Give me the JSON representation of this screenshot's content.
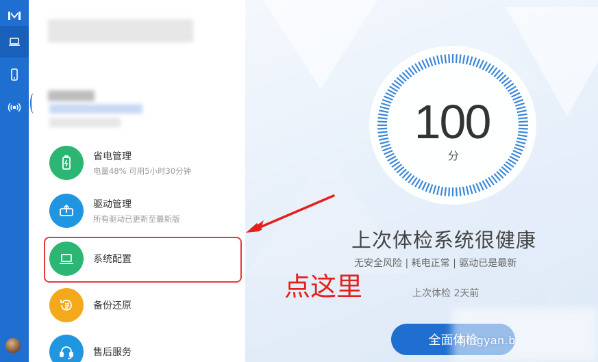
{
  "theme": {
    "accent": "#1f6fd1",
    "annotation": "#e5201c"
  },
  "rail": {
    "items": [
      {
        "icon": "brand-logo-icon"
      },
      {
        "icon": "laptop-icon"
      },
      {
        "icon": "phone-icon"
      },
      {
        "icon": "broadcast-icon"
      }
    ]
  },
  "menu": {
    "items": [
      {
        "title": "省电管理",
        "subtitle": "电量48% 可用5小时30分钟",
        "icon": "battery-icon",
        "color": "#2bb673"
      },
      {
        "title": "驱动管理",
        "subtitle": "所有驱动已更新至最新版",
        "icon": "driver-upload-icon",
        "color": "#2196e0"
      },
      {
        "title": "系统配置",
        "subtitle": "",
        "icon": "laptop-icon",
        "color": "#2bb673"
      },
      {
        "title": "备份还原",
        "subtitle": "",
        "icon": "backup-restore-icon",
        "color": "#f4a81c"
      },
      {
        "title": "售后服务",
        "subtitle": "",
        "icon": "headset-icon",
        "color": "#2196e0"
      }
    ]
  },
  "health": {
    "score": "100",
    "unit": "分",
    "title": "上次体检系统很健康",
    "detail": "无安全风险 | 耗电正常 | 驱动已是最新",
    "last_check": "上次体检 2天前",
    "button": "全面体检"
  },
  "annotation": {
    "text": "点这里"
  },
  "watermark": {
    "text": "jingyan.b"
  }
}
